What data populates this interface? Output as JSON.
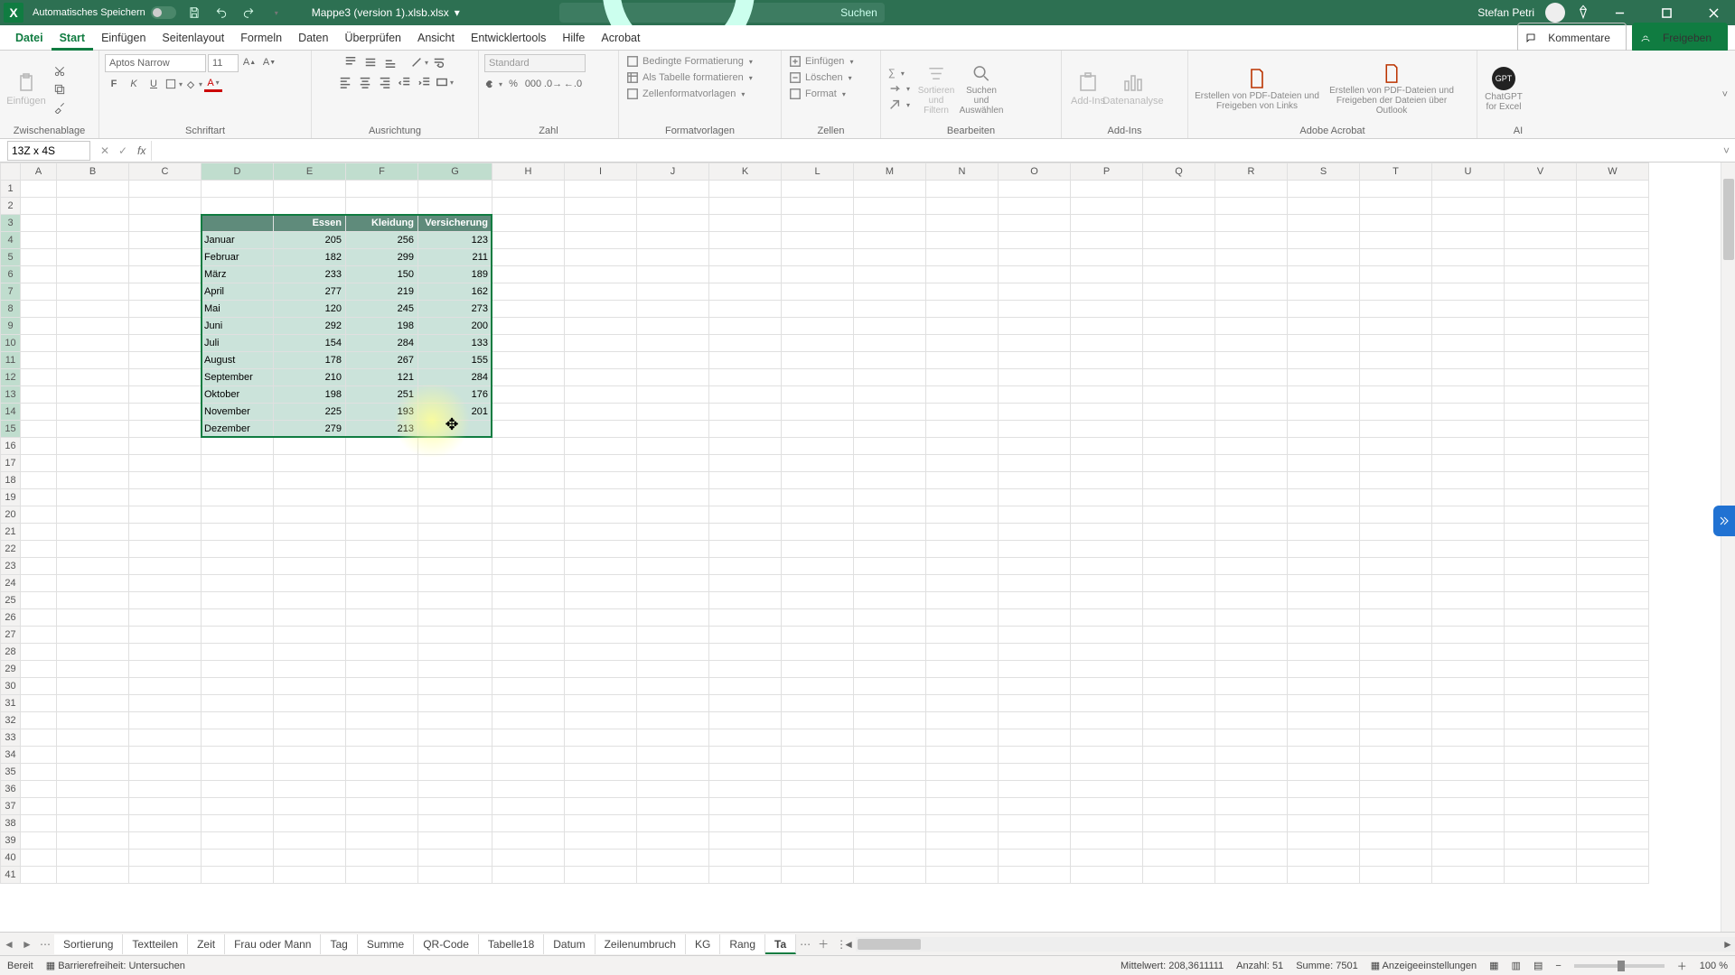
{
  "title": {
    "autosave": "Automatisches Speichern",
    "filename": "Mappe3 (version 1).xlsb.xlsx",
    "search_placeholder": "Suchen",
    "username": "Stefan Petri"
  },
  "tabs": {
    "datei": "Datei",
    "start": "Start",
    "einfuegen": "Einfügen",
    "seitenlayout": "Seitenlayout",
    "formeln": "Formeln",
    "daten": "Daten",
    "ueberpruefen": "Überprüfen",
    "ansicht": "Ansicht",
    "entwickler": "Entwicklertools",
    "hilfe": "Hilfe",
    "acrobat": "Acrobat",
    "kommentare": "Kommentare",
    "freigeben": "Freigeben"
  },
  "ribbon": {
    "clipboard": {
      "label": "Zwischenablage",
      "paste": "Einfügen"
    },
    "font": {
      "label": "Schriftart",
      "name": "Aptos Narrow",
      "size": "11"
    },
    "align": {
      "label": "Ausrichtung"
    },
    "number": {
      "label": "Zahl",
      "format": "Standard"
    },
    "styles": {
      "label": "Formatvorlagen",
      "cond": "Bedingte Formatierung",
      "astable": "Als Tabelle formatieren",
      "cellstyles": "Zellenformatvorlagen"
    },
    "cells": {
      "label": "Zellen",
      "insert": "Einfügen",
      "delete": "Löschen",
      "format": "Format"
    },
    "editing": {
      "label": "Bearbeiten",
      "sort": "Sortieren und Filtern",
      "find": "Suchen und Auswählen"
    },
    "addins": {
      "label": "Add-Ins",
      "addins": "Add-Ins",
      "analysis": "Datenanalyse"
    },
    "acrobat": {
      "label": "Adobe Acrobat",
      "create1": "Erstellen von PDF-Dateien und Freigeben von Links",
      "create2": "Erstellen von PDF-Dateien und Freigeben der Dateien über Outlook"
    },
    "ai": {
      "label": "AI",
      "chatgpt": "ChatGPT for Excel"
    }
  },
  "namebox": "13Z x 4S",
  "table": {
    "headers": [
      "",
      "Essen",
      "Kleidung",
      "Versicherung"
    ],
    "rows": [
      [
        "Januar",
        205,
        256,
        123
      ],
      [
        "Februar",
        182,
        299,
        211
      ],
      [
        "März",
        233,
        150,
        189
      ],
      [
        "April",
        277,
        219,
        162
      ],
      [
        "Mai",
        120,
        245,
        273
      ],
      [
        "Juni",
        292,
        198,
        200
      ],
      [
        "Juli",
        154,
        284,
        133
      ],
      [
        "August",
        178,
        267,
        155
      ],
      [
        "September",
        210,
        121,
        284
      ],
      [
        "Oktober",
        198,
        251,
        176
      ],
      [
        "November",
        225,
        193,
        201
      ],
      [
        "Dezember",
        279,
        213,
        ""
      ]
    ]
  },
  "sheets": [
    "Sortierung",
    "Textteilen",
    "Zeit",
    "Frau oder Mann",
    "Tag",
    "Summe",
    "QR-Code",
    "Tabelle18",
    "Datum",
    "Zeilenumbruch",
    "KG",
    "Rang",
    "Ta"
  ],
  "status": {
    "ready": "Bereit",
    "access": "Barrierefreiheit: Untersuchen",
    "avg_label": "Mittelwert:",
    "avg": "208,3611111",
    "count_label": "Anzahl:",
    "count": "51",
    "sum_label": "Summe:",
    "sum": "7501",
    "display": "Anzeigeeinstellungen",
    "zoom": "100 %"
  }
}
